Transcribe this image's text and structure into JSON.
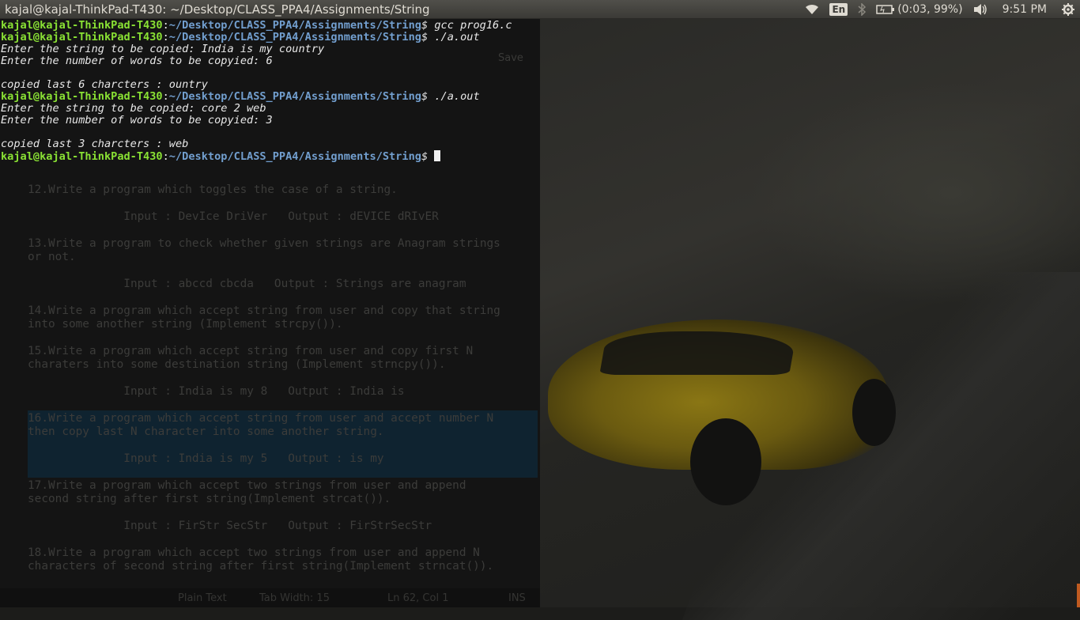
{
  "panel": {
    "window_title": "kajal@kajal-ThinkPad-T430: ~/Desktop/CLASS_PPA4/Assignments/String",
    "lang": "En",
    "battery": "(0:03, 99%)",
    "time": "9:51 PM",
    "icons": [
      "wifi-icon",
      "bluetooth-icon",
      "battery-icon",
      "volume-icon",
      "gear-icon"
    ]
  },
  "prompt": {
    "user": "kajal@kajal-ThinkPad-T430",
    "path": "~/Desktop/CLASS_PPA4/Assignments/String"
  },
  "terminal": [
    {
      "type": "cmd",
      "command": "gcc prog16.c"
    },
    {
      "type": "cmd",
      "command": "./a.out"
    },
    {
      "type": "out",
      "text": "Enter the string to be copied: India is my country"
    },
    {
      "type": "out",
      "text": "Enter the number of words to be copyied: 6"
    },
    {
      "type": "out",
      "text": ""
    },
    {
      "type": "out",
      "text": "copied last 6 charcters : ountry"
    },
    {
      "type": "cmd",
      "command": "./a.out"
    },
    {
      "type": "out",
      "text": "Enter the string to be copied: core 2 web"
    },
    {
      "type": "out",
      "text": "Enter the number of words to be copyied: 3"
    },
    {
      "type": "out",
      "text": ""
    },
    {
      "type": "out",
      "text": "copied last 3 charcters : web"
    },
    {
      "type": "cursor",
      "command": ""
    }
  ],
  "editor": {
    "save_label": "Save",
    "lines": [
      {
        "text": "12.Write a program which toggles the case of a string."
      },
      {
        "text": "              Input : DevIce DriVer   Output : dEVICE dRIvER"
      },
      {
        "text": "13.Write a program to check whether given strings are Anagram strings"
      },
      {
        "text": "or not."
      },
      {
        "text": "              Input : abccd cbcda   Output : Strings are anagram"
      },
      {
        "text": "14.Write a program which accept string from user and copy that string"
      },
      {
        "text": "into some another string (Implement strcpy())."
      },
      {
        "text": "15.Write a program which accept string from user and copy first N"
      },
      {
        "text": "charaters into some destination string (Implement strncpy())."
      },
      {
        "text": "              Input : India is my 8   Output : India is"
      },
      {
        "text": "16.Write a program which accept string from user and accept number N"
      },
      {
        "text": "then copy last N character into some another string."
      },
      {
        "text": "              Input : India is my 5   Output : is my"
      },
      {
        "text": "17.Write a program which accept two strings from user and append"
      },
      {
        "text": "second string after first string(Implement strcat())."
      },
      {
        "text": "              Input : FirStr SecStr   Output : FirStrSecStr"
      },
      {
        "text": "18.Write a program which accept two strings from user and append N"
      },
      {
        "text": "characters of second string after first string(Implement strncat())."
      }
    ],
    "status": {
      "syntax": "Plain Text",
      "tab_width": "Tab Width: 15",
      "position": "Ln 62, Col 1",
      "mode": "INS"
    }
  }
}
